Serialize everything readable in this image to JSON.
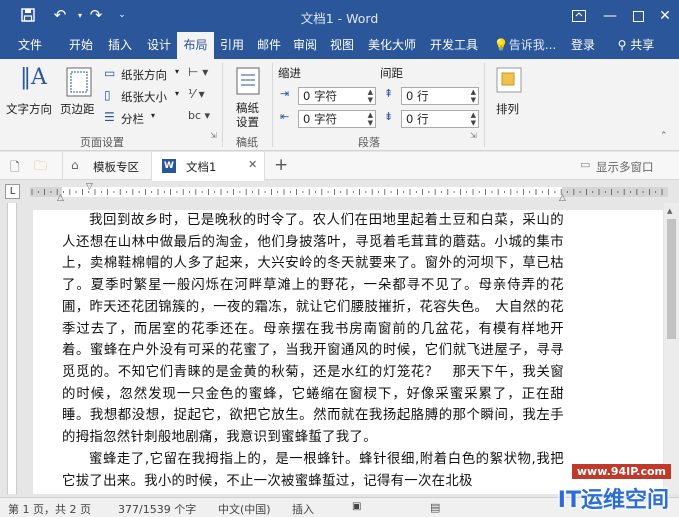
{
  "window": {
    "title": "文档1 - Word"
  },
  "ribbon_tabs": [
    {
      "label": "文件"
    },
    {
      "label": "开始"
    },
    {
      "label": "插入"
    },
    {
      "label": "设计"
    },
    {
      "label": "布局"
    },
    {
      "label": "引用"
    },
    {
      "label": "邮件"
    },
    {
      "label": "审阅"
    },
    {
      "label": "视图"
    },
    {
      "label": "美化大师"
    },
    {
      "label": "开发工具"
    }
  ],
  "tellme": "告诉我...",
  "login": "登录",
  "share": "共享",
  "page_setup": {
    "text_direction": "文字方向",
    "margins": "页边距",
    "orientation": "纸张方向",
    "size": "纸张大小",
    "columns": "分栏",
    "label": "页面设置"
  },
  "manuscript": {
    "button": "稿纸\n设置",
    "label": "稿纸"
  },
  "paragraph": {
    "indent_label": "缩进",
    "spacing_label": "间距",
    "indent_left": "0 字符",
    "indent_right": "0 字符",
    "spacing_before": "0 行",
    "spacing_after": "0 行",
    "label": "段落"
  },
  "arrange": {
    "label": "排列"
  },
  "doc_tabs": [
    {
      "label": "模板专区"
    },
    {
      "label": "文档1"
    }
  ],
  "show_windows": "显示多窗口",
  "document": {
    "para1": "我回到故乡时，已是晚秋的时令了。农人们在田地里起着土豆和白菜，采山的人还想在山林中做最后的淘金，他们身披落叶，寻觅着毛茸茸的蘑菇。小城的集市上，卖棉鞋棉帽的人多了起来，大兴安岭的冬天就要来了。窗外的河坝下，草已枯了。夏季时繁星一般闪烁在河畔草滩上的野花，一朵都寻不见了。母亲侍弄的花圃，昨天还花团锦簇的，一夜的霜冻，就让它们腰肢摧折，花容失色。　大自然的花季过去了，而居室的花季还在。母亲摆在我书房南窗前的几盆花，有模有样地开着。蜜蜂在户外没有可采的花蜜了，当我开窗通风的时候，它们就飞进屋子，寻寻觅觅的。不知它们青睐的是金黄的秋菊，还是水红的灯笼花？　那天下午，我关窗的时候，忽然发现一只金色的蜜蜂，它蜷缩在窗棂下，好像采蜜采累了，正在甜睡。我想都没想，捉起它，欲把它放生。然而就在我扬起胳膊的那个瞬间，我左手的拇指忽然针刺般地剧痛，我意识到蜜蜂蜇了我了。",
    "para2": "蜜蜂走了,它留在我拇指上的，是一根蜂针。蜂针很细,附着白色的絮状物,我把它拔了出来。我小的时候，不止一次被蜜蜂蜇过，记得有一次在北极"
  },
  "status": {
    "page": "第 1 页，共 2 页",
    "words": "377/1539 个字",
    "language": "中文(中国)",
    "mode": "插入"
  },
  "watermark": {
    "url": "www.94IP.com",
    "brand": "IT运维空间"
  }
}
